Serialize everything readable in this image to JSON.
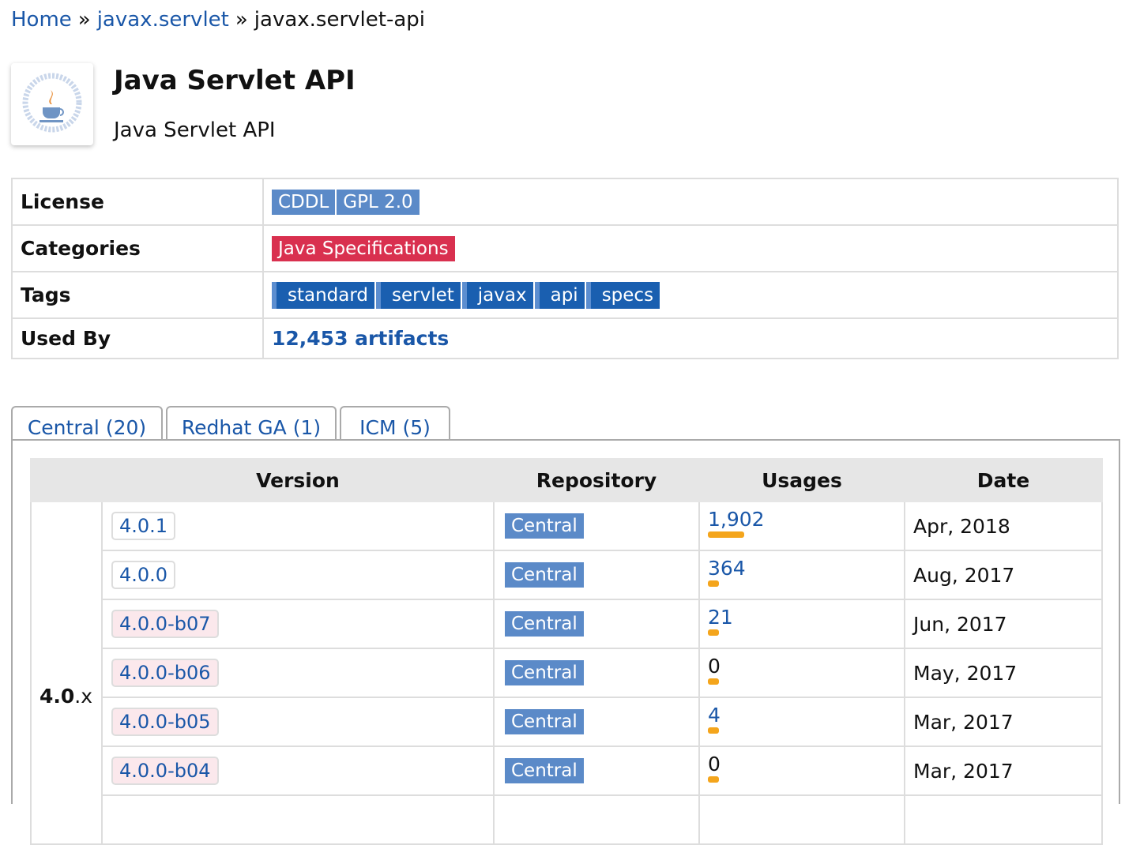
{
  "breadcrumb": {
    "home": "Home",
    "group": "javax.servlet",
    "separator": "»",
    "current": "javax.servlet-api"
  },
  "header": {
    "title": "Java Servlet API",
    "subtitle": "Java Servlet API",
    "logo_icon": "java-community-process-logo"
  },
  "info": {
    "license_label": "License",
    "licenses": [
      "CDDL",
      "GPL 2.0"
    ],
    "categories_label": "Categories",
    "category": "Java Specifications",
    "tags_label": "Tags",
    "tags": [
      "standard",
      "servlet",
      "javax",
      "api",
      "specs"
    ],
    "used_by_label": "Used By",
    "used_by": "12,453 artifacts"
  },
  "tabs": [
    {
      "label": "Central (20)",
      "active": true
    },
    {
      "label": "Redhat GA (1)",
      "active": false
    },
    {
      "label": "ICM (5)",
      "active": false
    }
  ],
  "versions_table": {
    "headers": [
      "Version",
      "Repository",
      "Usages",
      "Date"
    ],
    "group_label_bold": "4.0",
    "group_label_suffix": ".x",
    "rows": [
      {
        "version": "4.0.1",
        "beta": false,
        "repository": "Central",
        "usages": "1,902",
        "usage_fraction": 1.0,
        "date": "Apr, 2018"
      },
      {
        "version": "4.0.0",
        "beta": false,
        "repository": "Central",
        "usages": "364",
        "usage_fraction": 0.19,
        "date": "Aug, 2017"
      },
      {
        "version": "4.0.0-b07",
        "beta": true,
        "repository": "Central",
        "usages": "21",
        "usage_fraction": 0.011,
        "date": "Jun, 2017"
      },
      {
        "version": "4.0.0-b06",
        "beta": true,
        "repository": "Central",
        "usages": "0",
        "usage_fraction": 0,
        "date": "May, 2017"
      },
      {
        "version": "4.0.0-b05",
        "beta": true,
        "repository": "Central",
        "usages": "4",
        "usage_fraction": 0.002,
        "date": "Mar, 2017"
      },
      {
        "version": "4.0.0-b04",
        "beta": true,
        "repository": "Central",
        "usages": "0",
        "usage_fraction": 0,
        "date": "Mar, 2017"
      }
    ]
  },
  "colors": {
    "link": "#1a57a8",
    "license_badge": "#5b8ac8",
    "category_badge": "#d9304f",
    "tag_badge": "#1a5fb0",
    "usage_bar": "#f4a51c",
    "beta_bg": "#fbe8ec"
  }
}
